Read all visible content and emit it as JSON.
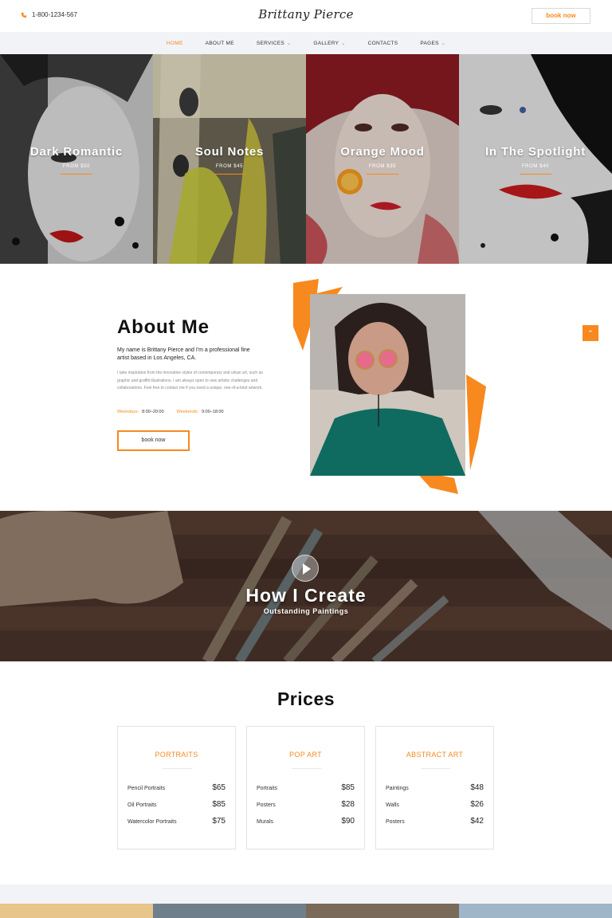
{
  "header": {
    "phone": "1-800-1234-567",
    "brand": "Brittany Pierce",
    "book_label": "book now"
  },
  "nav": {
    "items": [
      {
        "label": "HOME",
        "active": true,
        "has_dropdown": false
      },
      {
        "label": "ABOUT ME",
        "active": false,
        "has_dropdown": false
      },
      {
        "label": "SERVICES",
        "active": false,
        "has_dropdown": true
      },
      {
        "label": "GALLERY",
        "active": false,
        "has_dropdown": true
      },
      {
        "label": "CONTACTS",
        "active": false,
        "has_dropdown": false
      },
      {
        "label": "PAGES",
        "active": false,
        "has_dropdown": true
      }
    ]
  },
  "hero": {
    "panels": [
      {
        "title": "Dark Romantic",
        "price": "FROM $50"
      },
      {
        "title": "Soul Notes",
        "price": "FROM $45"
      },
      {
        "title": "Orange Mood",
        "price": "FROM $35"
      },
      {
        "title": "In The Spotlight",
        "price": "FROM $40"
      }
    ]
  },
  "about": {
    "title": "About Me",
    "lead": "My name is Brittany Pierce and I'm a professional fine artist based in Los Angeles, CA.",
    "body": "I take inspiration from the innovative styles of contemporary and urban art, such as graphic and graffiti illustrations. I am always open to new artistic challenges and collaborations. Feel free to contact me if you need a unique, one-of-a-kind artwork.",
    "weekdays_label": "Weekdays:",
    "weekdays_hours": "8:00–20:00",
    "weekends_label": "Weekends:",
    "weekends_hours": "9:00–18:00",
    "book_label": "book now"
  },
  "create": {
    "title": "How I Create",
    "subtitle": "Outstanding Paintings"
  },
  "prices": {
    "title": "Prices",
    "cards": [
      {
        "title": "PORTRAITS",
        "rows": [
          {
            "name": "Pencil Portraits",
            "price": "$65"
          },
          {
            "name": "Oil Portraits",
            "price": "$85"
          },
          {
            "name": "Watercolor Portraits",
            "price": "$75"
          }
        ]
      },
      {
        "title": "POP ART",
        "rows": [
          {
            "name": "Portraits",
            "price": "$85"
          },
          {
            "name": "Posters",
            "price": "$28"
          },
          {
            "name": "Murals",
            "price": "$90"
          }
        ]
      },
      {
        "title": "ABSTRACT ART",
        "rows": [
          {
            "name": "Paintings",
            "price": "$48"
          },
          {
            "name": "Walls",
            "price": "$26"
          },
          {
            "name": "Posters",
            "price": "$42"
          }
        ]
      }
    ]
  },
  "colors": {
    "accent": "#f7891e",
    "nav_bg": "#f2f3f7"
  },
  "icons": {
    "phone": "phone-icon",
    "scroll_up": "chevron-up-icon",
    "play": "play-icon"
  }
}
